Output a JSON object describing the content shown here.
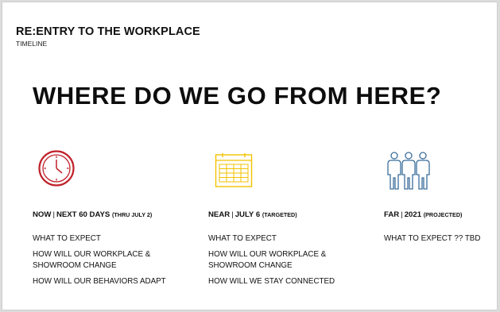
{
  "header": {
    "title": "RE:ENTRY TO THE WORKPLACE",
    "subtitle": "TIMELINE"
  },
  "headline": "WHERE DO WE GO FROM HERE?",
  "colors": {
    "clock": "#c0222a",
    "calendar": "#f2c200",
    "people": "#3b6e9b"
  },
  "columns": [
    {
      "icon": "clock-icon",
      "phase": "NOW",
      "separator": "|",
      "range": "NEXT 60 DAYS",
      "note": "(THRU JULY 2)",
      "items": [
        "WHAT TO EXPECT",
        "HOW WILL OUR WORKPLACE & SHOWROOM CHANGE",
        "HOW WILL OUR BEHAVIORS ADAPT"
      ]
    },
    {
      "icon": "calendar-icon",
      "phase": "NEAR",
      "separator": "|",
      "range": "JULY 6",
      "note": "(TARGETED)",
      "items": [
        "WHAT TO EXPECT",
        "HOW WILL OUR WORKPLACE & SHOWROOM CHANGE",
        "HOW WILL WE STAY CONNECTED"
      ]
    },
    {
      "icon": "people-icon",
      "phase": "FAR",
      "separator": "|",
      "range": "2021",
      "note": "(PROJECTED)",
      "items": [
        "WHAT TO EXPECT ?? TBD"
      ]
    }
  ]
}
